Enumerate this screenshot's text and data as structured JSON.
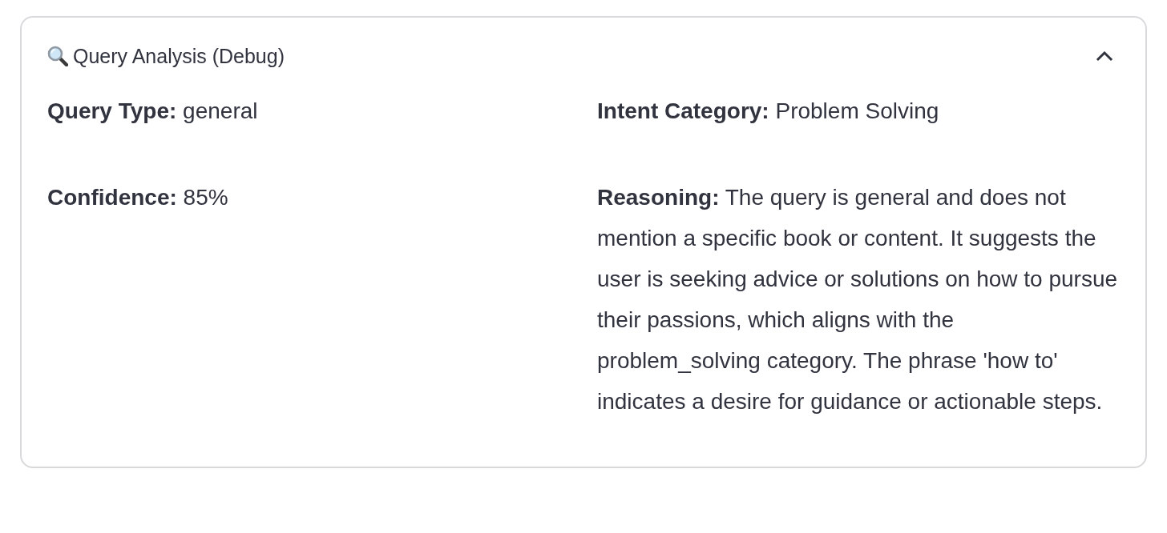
{
  "expander": {
    "title": "Query Analysis (Debug)",
    "expanded": true
  },
  "columns": [
    {
      "fields": [
        {
          "label": "Query Type:",
          "value": "general"
        },
        {
          "label": "Confidence:",
          "value": "85%"
        }
      ]
    },
    {
      "fields": [
        {
          "label": "Intent Category:",
          "value": "Problem Solving"
        },
        {
          "label": "Reasoning:",
          "value": "The query is general and does not mention a specific book or content. It suggests the user is seeking advice or solutions on how to pursue their passions, which aligns with the problem_solving category. The phrase 'how to' indicates a desire for guidance or actionable steps."
        }
      ]
    }
  ]
}
